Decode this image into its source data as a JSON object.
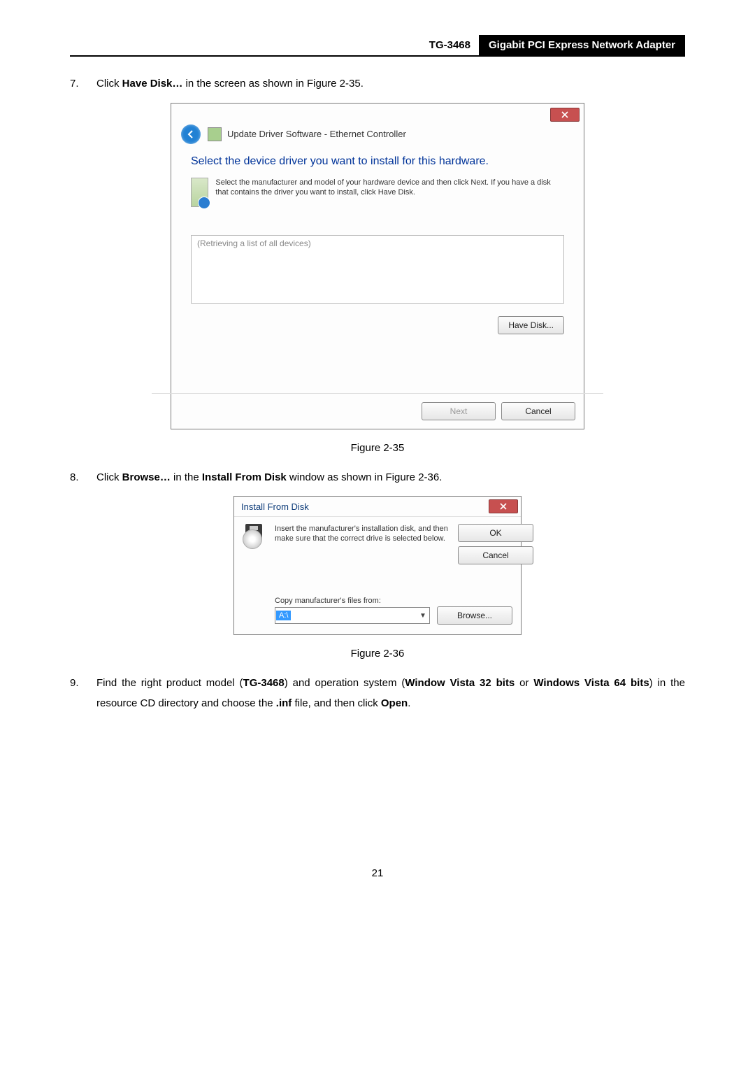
{
  "header": {
    "model": "TG-3468",
    "title": "Gigabit PCI Express Network Adapter"
  },
  "steps": {
    "s7": {
      "num": "7.",
      "pre": "Click ",
      "bold": "Have Disk…",
      "post": " in the screen as shown in Figure 2-35."
    },
    "s8": {
      "num": "8.",
      "pre": "Click ",
      "bold1": "Browse…",
      "mid": " in the ",
      "bold2": "Install From Disk",
      "post": " window as shown in Figure 2-36."
    },
    "s9": {
      "num": "9.",
      "t1": "Find the right product model (",
      "b1": "TG-3468",
      "t2": ") and operation system (",
      "b2": "Window Vista 32 bits",
      "t3": " or ",
      "b3": "Windows Vista 64 bits",
      "t4": ") in the resource CD directory and choose the ",
      "b4": ".inf",
      "t5": " file, and then click ",
      "b5": "Open",
      "t6": "."
    }
  },
  "dialog1": {
    "window_title": "Update Driver Software - Ethernet Controller",
    "heading": "Select the device driver you want to install for this hardware.",
    "info": "Select the manufacturer and model of your hardware device and then click Next. If you have a disk that contains the driver you want to install, click Have Disk.",
    "list_placeholder": "(Retrieving a list of all devices)",
    "have_disk": "Have Disk...",
    "next": "Next",
    "cancel": "Cancel"
  },
  "dialog2": {
    "title": "Install From Disk",
    "msg": "Insert the manufacturer's installation disk, and then make sure that the correct drive is selected below.",
    "ok": "OK",
    "cancel": "Cancel",
    "copy_label": "Copy manufacturer's files from:",
    "combo_value": "A:\\",
    "browse": "Browse..."
  },
  "captions": {
    "fig35": "Figure 2-35",
    "fig36": "Figure 2-36"
  },
  "page_number": "21"
}
